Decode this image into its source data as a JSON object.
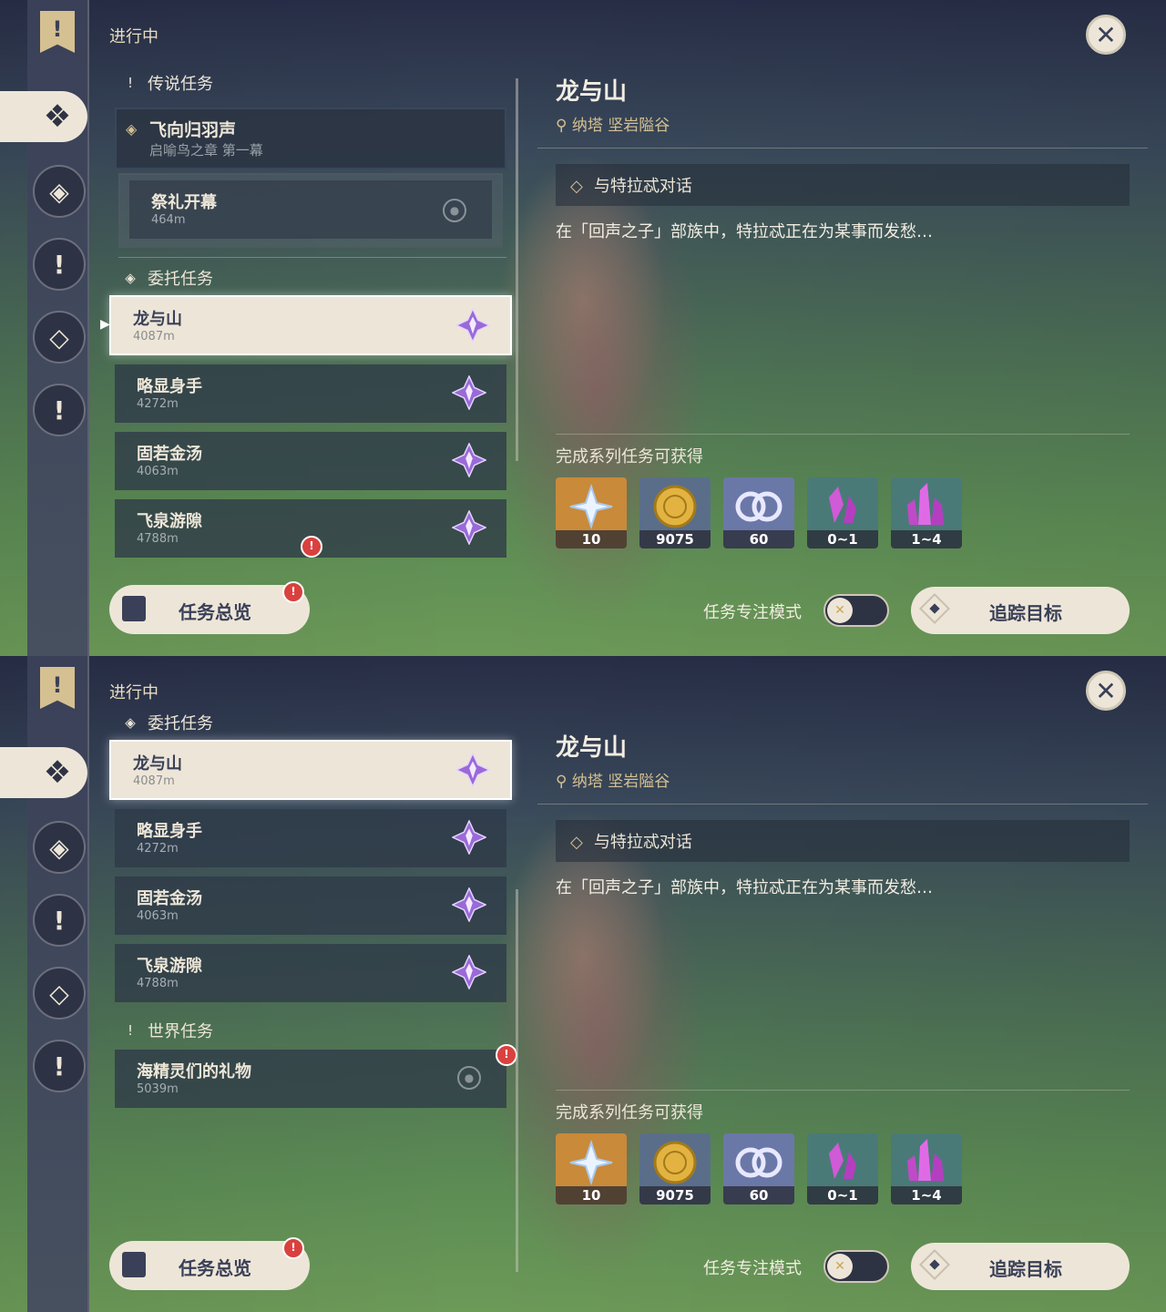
{
  "app": {
    "status_title": "进行中"
  },
  "sections": {
    "legend": "传说任务",
    "commission": "委托任务",
    "world": "世界任务"
  },
  "legend_quest": {
    "name": "飞向归羽声",
    "chapter": "启喻鸟之章 第一幕"
  },
  "legend_sub": {
    "name": "祭礼开幕",
    "dist": "464m"
  },
  "commissions": [
    {
      "name": "龙与山",
      "dist": "4087m"
    },
    {
      "name": "略显身手",
      "dist": "4272m"
    },
    {
      "name": "固若金汤",
      "dist": "4063m"
    },
    {
      "name": "飞泉游隙",
      "dist": "4788m"
    }
  ],
  "world_quest": {
    "name": "海精灵们的礼物",
    "dist": "5039m"
  },
  "detail": {
    "title": "龙与山",
    "location": "纳塔 坚岩隘谷",
    "objective": "与特拉忒对话",
    "description": "在「回声之子」部族中，特拉忒正在为某事而发愁…",
    "rewards_label": "完成系列任务可获得",
    "rewards": [
      {
        "icon": "primogem-icon",
        "count": "10",
        "bg": "#c98a3a"
      },
      {
        "icon": "mora-icon",
        "count": "9075",
        "bg": "#5a6e8a"
      },
      {
        "icon": "adventure-exp-icon",
        "count": "60",
        "bg": "#6a78a8"
      },
      {
        "icon": "crystal-small-icon",
        "count": "0~1",
        "bg": "#4a7a78"
      },
      {
        "icon": "crystal-large-icon",
        "count": "1~4",
        "bg": "#4a7a78"
      }
    ]
  },
  "footer": {
    "overview": "任务总览",
    "focus_mode": "任务专注模式",
    "track": "追踪目标"
  },
  "colors": {
    "accent": "#d5c091",
    "selected_bg": "#ede6d8",
    "row_bg": "#2e3a48",
    "alert": "#d9413e"
  }
}
